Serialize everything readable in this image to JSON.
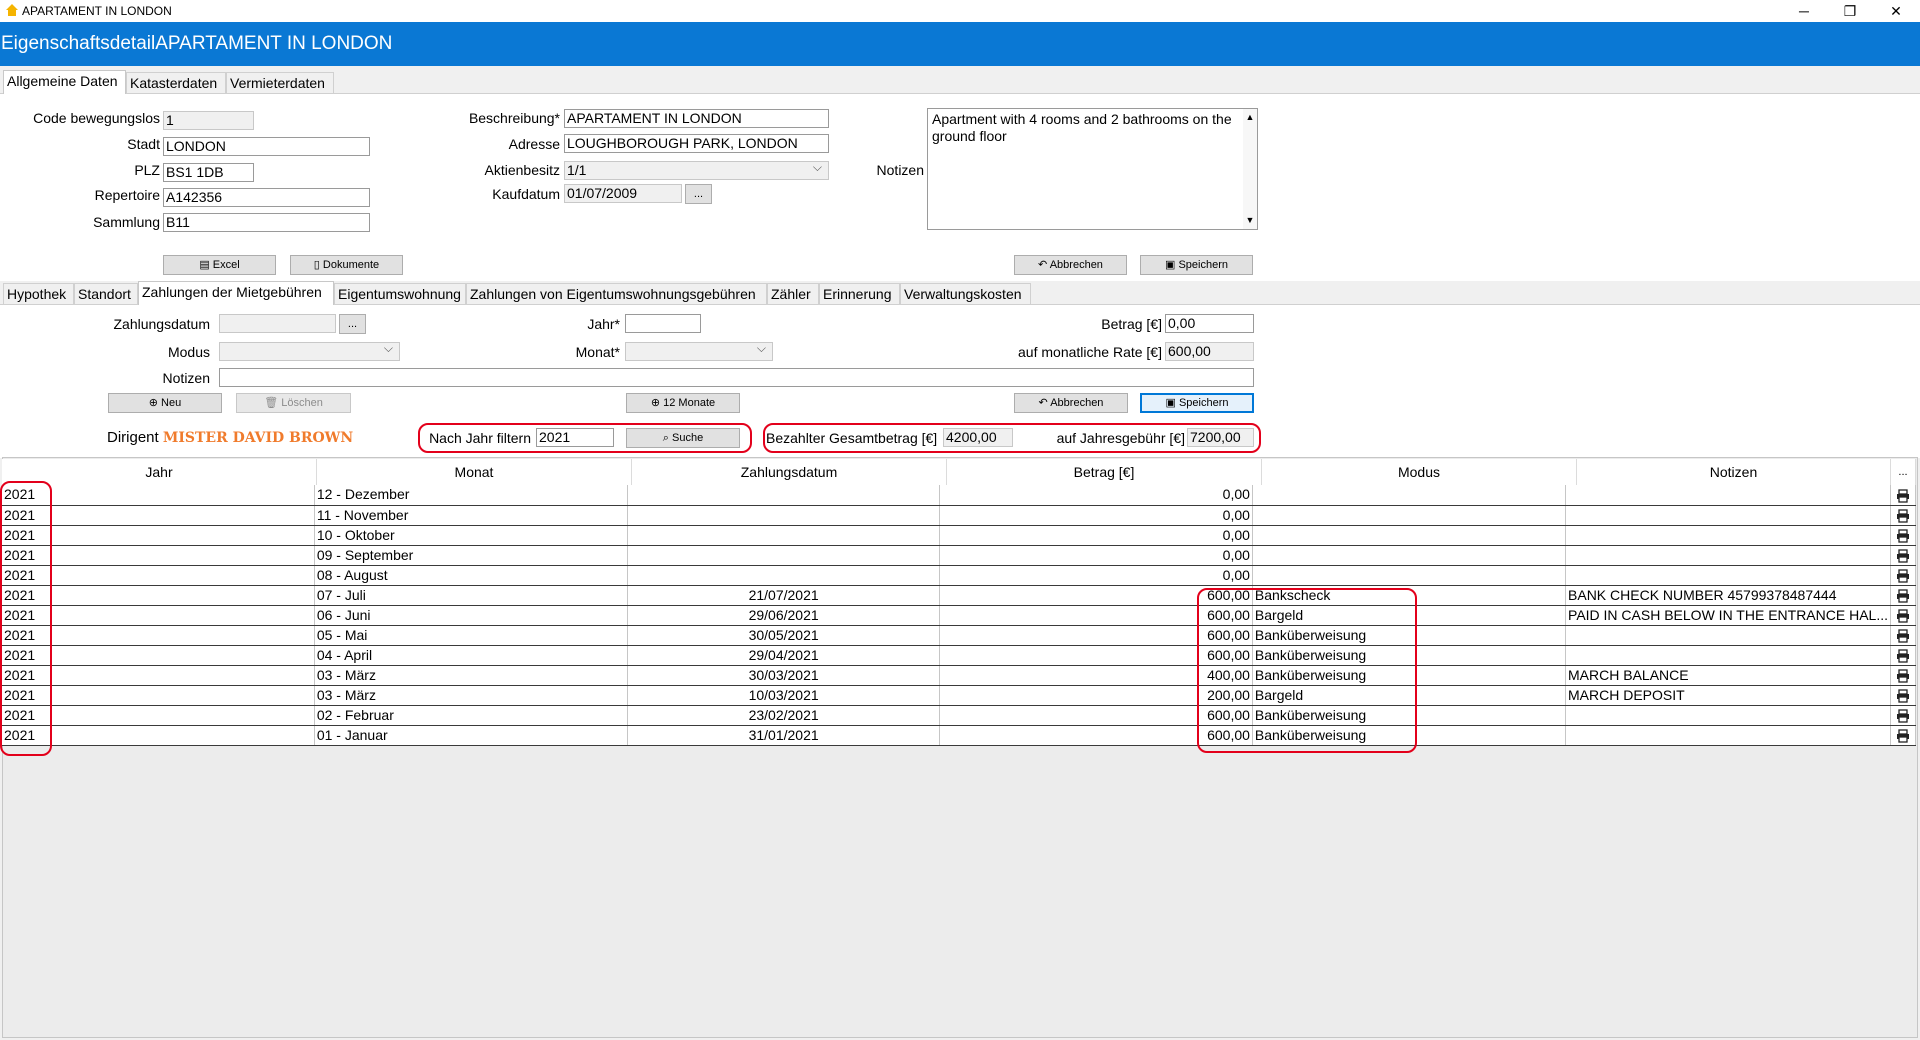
{
  "window": {
    "title": "APARTAMENT IN LONDON",
    "min": "─",
    "restore": "❐",
    "close": "✕"
  },
  "header": {
    "title": "EigenschaftsdetailAPARTAMENT IN LONDON"
  },
  "main_tabs": [
    "Allgemeine Daten",
    "Katasterdaten",
    "Vermieterdaten"
  ],
  "general": {
    "code_label": "Code bewegungslos",
    "code_value": "1",
    "stadt_label": "Stadt",
    "stadt_value": "LONDON",
    "plz_label": "PLZ",
    "plz_value": "BS1 1DB",
    "repertoire_label": "Repertoire",
    "repertoire_value": "A142356",
    "sammlung_label": "Sammlung",
    "sammlung_value": "B11",
    "beschreibung_label": "Beschreibung*",
    "beschreibung_value": "APARTAMENT IN LONDON",
    "adresse_label": "Adresse",
    "adresse_value": "LOUGHBOROUGH PARK, LONDON",
    "aktienbesitz_label": "Aktienbesitz",
    "aktienbesitz_value": "1/1",
    "kaufdatum_label": "Kaufdatum",
    "kaufdatum_value": "01/07/2009",
    "notizen_label": "Notizen",
    "notizen_value": "Apartment with 4 rooms and 2 bathrooms on the ground floor",
    "excel": "Excel",
    "dokumente": "Dokumente",
    "abbrechen": "Abbrechen",
    "speichern": "Speichern",
    "ellipsis": "..."
  },
  "sub_tabs": [
    "Hypothek",
    "Standort",
    "Zahlungen der Mietgebühren",
    "Eigentumswohnung",
    "Zahlungen von Eigentumswohnungsgebühren",
    "Zähler",
    "Erinnerung",
    "Verwaltungskosten"
  ],
  "payment_form": {
    "zahlungsdatum_label": "Zahlungsdatum",
    "zahlungsdatum_value": "",
    "modus_label": "Modus",
    "modus_value": "",
    "notizen_label": "Notizen",
    "notizen_value": "",
    "jahr_label": "Jahr*",
    "jahr_value": "",
    "monat_label": "Monat*",
    "monat_value": "",
    "betrag_label": "Betrag [€]",
    "betrag_value": "0,00",
    "rate_label": "auf monatliche Rate [€]",
    "rate_value": "600,00",
    "neu": "Neu",
    "loeschen": "Löschen",
    "zwoelf_monate": "12 Monate",
    "abbrechen": "Abbrechen",
    "speichern": "Speichern",
    "ellipsis": "..."
  },
  "filter": {
    "dirigent_label": "Dirigent",
    "dirigent_value": "MISTER DAVID BROWN",
    "filter_label": "Nach Jahr filtern",
    "filter_value": "2021",
    "suche": "Suche",
    "total_label": "Bezahlter Gesamtbetrag [€]",
    "total_value": "4200,00",
    "annual_label": "auf Jahresgebühr [€]",
    "annual_value": "7200,00"
  },
  "grid": {
    "columns": [
      "Jahr",
      "Monat",
      "Zahlungsdatum",
      "Betrag [€]",
      "Modus",
      "Notizen",
      "..."
    ],
    "rows": [
      [
        "2021",
        "12 - Dezember",
        "",
        "0,00",
        "",
        ""
      ],
      [
        "2021",
        "11 - November",
        "",
        "0,00",
        "",
        ""
      ],
      [
        "2021",
        "10 - Oktober",
        "",
        "0,00",
        "",
        ""
      ],
      [
        "2021",
        "09 - September",
        "",
        "0,00",
        "",
        ""
      ],
      [
        "2021",
        "08 - August",
        "",
        "0,00",
        "",
        ""
      ],
      [
        "2021",
        "07 - Juli",
        "21/07/2021",
        "600,00",
        "Bankscheck",
        "BANK CHECK NUMBER 45799378487444"
      ],
      [
        "2021",
        "06 - Juni",
        "29/06/2021",
        "600,00",
        "Bargeld",
        "PAID IN CASH BELOW IN THE ENTRANCE HAL..."
      ],
      [
        "2021",
        "05 - Mai",
        "30/05/2021",
        "600,00",
        "Banküberweisung",
        ""
      ],
      [
        "2021",
        "04 - April",
        "29/04/2021",
        "600,00",
        "Banküberweisung",
        ""
      ],
      [
        "2021",
        "03 - März",
        "30/03/2021",
        "400,00",
        "Banküberweisung",
        "MARCH BALANCE"
      ],
      [
        "2021",
        "03 - März",
        "10/03/2021",
        "200,00",
        "Bargeld",
        "MARCH DEPOSIT"
      ],
      [
        "2021",
        "02 - Februar",
        "23/02/2021",
        "600,00",
        "Banküberweisung",
        ""
      ],
      [
        "2021",
        "01 - Januar",
        "31/01/2021",
        "600,00",
        "Banküberweisung",
        ""
      ]
    ]
  },
  "colors": {
    "header_bg": "#0a78d4",
    "dirigent_name": "#f07b2c",
    "annotation": "#e3001b"
  }
}
